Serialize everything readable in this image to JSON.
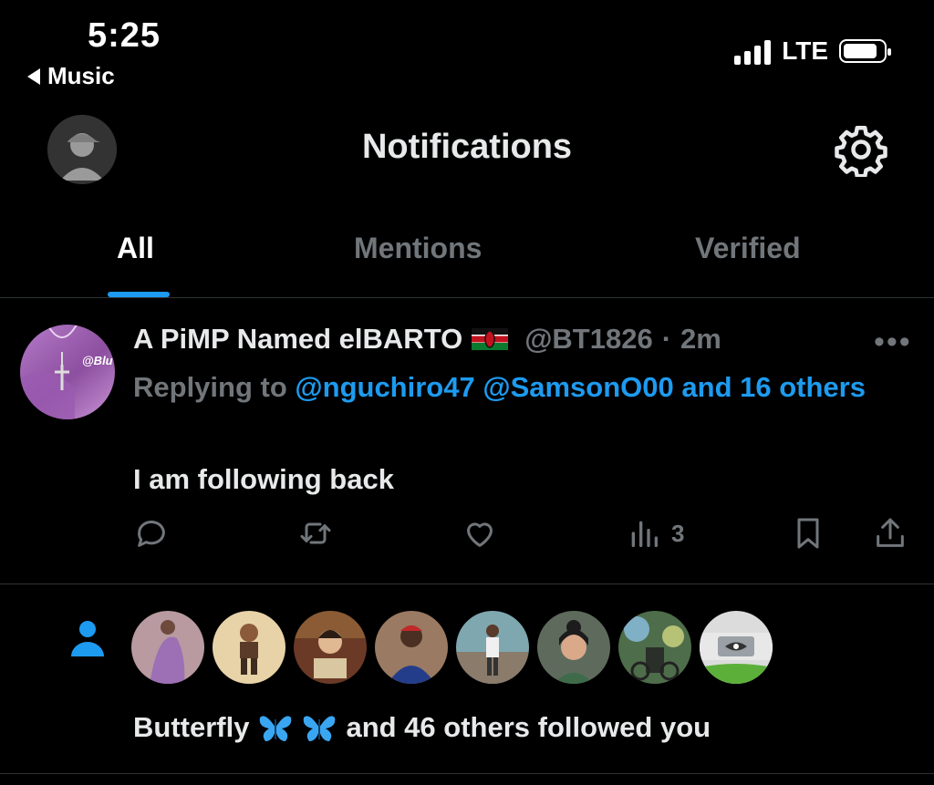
{
  "status_bar": {
    "time": "5:25",
    "back_app": "Music",
    "network": "LTE"
  },
  "header": {
    "title": "Notifications",
    "avatar_icon": "profile-avatar-icon",
    "settings_icon": "gear-icon"
  },
  "tabs": [
    {
      "label": "All",
      "active": true
    },
    {
      "label": "Mentions",
      "active": false
    },
    {
      "label": "Verified",
      "active": false
    }
  ],
  "tweet": {
    "author_name": "A PiMP Named elBARTO",
    "flag": "kenya-flag-emoji",
    "handle": "@BT1826",
    "separator": "·",
    "time": "2m",
    "more": "•••",
    "replying_prefix": "Replying to",
    "mention_1": "@nguchiro47",
    "mention_2": "@SamsonO00",
    "mention_rest": "and 16 others",
    "avatar_watermark": "@Blu",
    "text": "I am following back",
    "views": "3"
  },
  "follow_notification": {
    "icon": "person-icon",
    "name": "Butterfly",
    "emoji": "butterfly-emoji",
    "suffix": "and 46 others followed you",
    "follower_count_shown": 8
  },
  "colors": {
    "background": "#000000",
    "text_primary": "#e7e9ea",
    "text_secondary": "#71767b",
    "accent": "#1d9bf0",
    "divider": "#2f3336"
  }
}
